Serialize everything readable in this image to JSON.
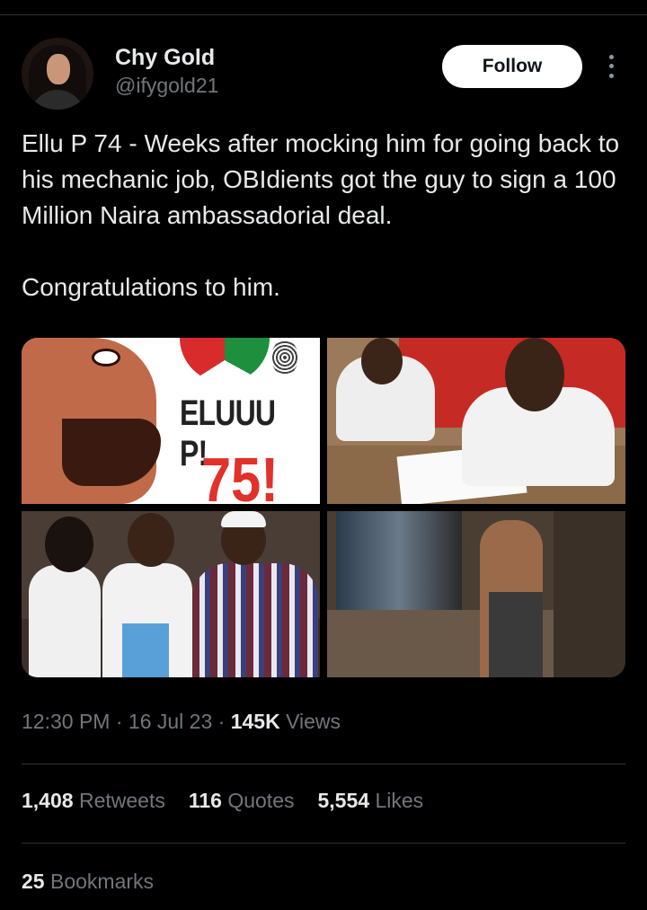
{
  "author": {
    "name": "Chy Gold",
    "handle": "@ifygold21",
    "follow_label": "Follow"
  },
  "tweet": {
    "paragraph1": "Ellu P 74 - Weeks after mocking him for going back to his mechanic job, OBIdients got the guy to sign a 100 Million Naira ambassadorial deal.",
    "paragraph2": "Congratulations to him."
  },
  "media": {
    "image1_text": "ELUUU P!",
    "image1_number": "75!"
  },
  "meta": {
    "time": "12:30 PM",
    "date": "16 Jul 23",
    "views_count": "145K",
    "views_label": "Views",
    "separator": "·"
  },
  "stats": {
    "retweets_count": "1,408",
    "retweets_label": "Retweets",
    "quotes_count": "116",
    "quotes_label": "Quotes",
    "likes_count": "5,554",
    "likes_label": "Likes",
    "bookmarks_count": "25",
    "bookmarks_label": "Bookmarks"
  },
  "icons": {
    "more": "more-vertical-icon"
  }
}
